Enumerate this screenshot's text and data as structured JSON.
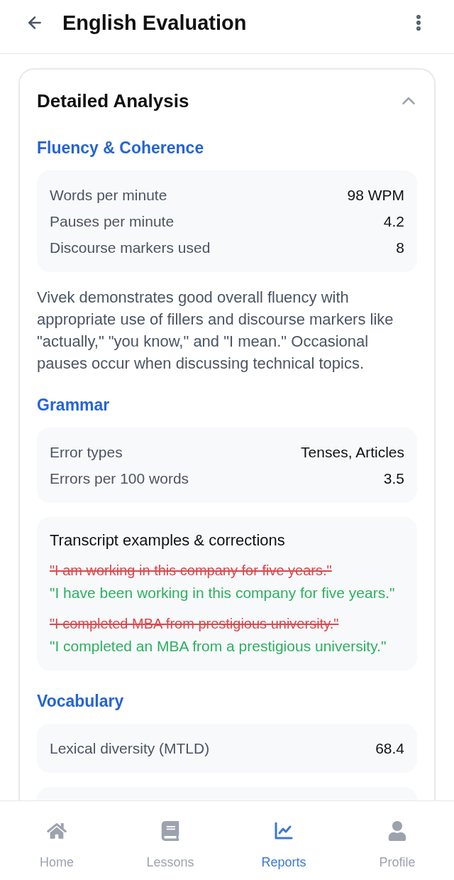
{
  "header": {
    "title": "English Evaluation"
  },
  "card": {
    "title": "Detailed Analysis",
    "expanded": true,
    "sections": [
      {
        "heading": "Fluency & Coherence",
        "blocks": [
          {
            "kind": "stats",
            "rows": [
              {
                "label": "Words per minute",
                "value": "98 WPM"
              },
              {
                "label": "Pauses per minute",
                "value": "4.2"
              },
              {
                "label": "Discourse markers used",
                "value": "8"
              }
            ]
          },
          {
            "kind": "paragraph",
            "text": "Vivek demonstrates good overall fluency with appropriate use of fillers and discourse markers like \"actually,\" \"you know,\" and \"I mean.\" Occasional pauses occur when discussing technical topics."
          }
        ]
      },
      {
        "heading": "Grammar",
        "blocks": [
          {
            "kind": "stats",
            "rows": [
              {
                "label": "Error types",
                "value": "Tenses, Articles"
              },
              {
                "label": "Errors per 100 words",
                "value": "3.5"
              }
            ]
          },
          {
            "kind": "examples",
            "title": "Transcript examples & corrections",
            "pairs": [
              {
                "original": "\"I am working in this company for five years.\"",
                "corrected": "\"I have been working in this company for five years.\""
              },
              {
                "original": "\"I completed MBA from prestigious university.\"",
                "corrected": "\"I completed an MBA from a prestigious university.\""
              }
            ]
          }
        ]
      },
      {
        "heading": "Vocabulary",
        "blocks": [
          {
            "kind": "stats",
            "rows": [
              {
                "label": "Lexical diversity (MTLD)",
                "value": "68.4"
              }
            ]
          },
          {
            "kind": "panel"
          }
        ]
      }
    ]
  },
  "nav": {
    "items": [
      {
        "label": "Home",
        "selected": false
      },
      {
        "label": "Lessons",
        "selected": false
      },
      {
        "label": "Reports",
        "selected": true
      },
      {
        "label": "Profile",
        "selected": false
      }
    ]
  }
}
